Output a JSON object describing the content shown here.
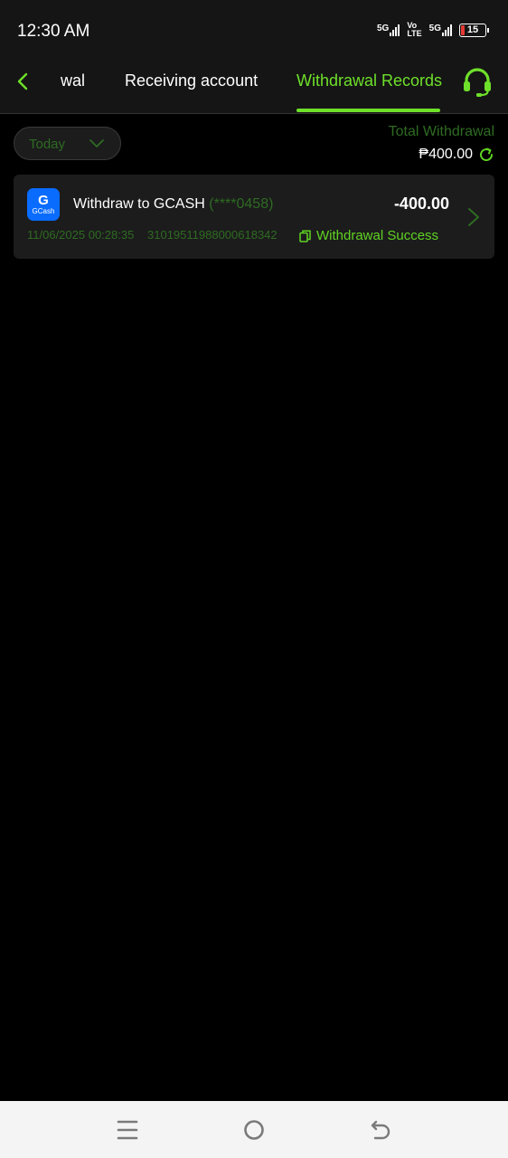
{
  "status_bar": {
    "time": "12:30 AM",
    "network1": "5G",
    "volte_top": "Vo",
    "volte_bottom": "LTE",
    "network2": "5G",
    "battery": "15"
  },
  "nav": {
    "back_icon": "chevron-left-icon",
    "tabs": [
      {
        "label": "wal"
      },
      {
        "label": "Receiving account"
      },
      {
        "label": "Withdrawal Records",
        "active": true
      }
    ],
    "support_icon": "headset-icon"
  },
  "filter": {
    "selected": "Today"
  },
  "summary": {
    "label": "Total Withdrawal",
    "value": "₱400.00"
  },
  "records": [
    {
      "logo_letter": "G",
      "logo_text": "GCash",
      "title": "Withdraw to GCASH",
      "account": "(****0458)",
      "amount": "-400.00",
      "date": "11/06/2025 00:28:35",
      "id": "31019511988000618342",
      "status": "Withdrawal Success"
    }
  ],
  "colors": {
    "accent": "#6ee02a",
    "muted_green": "#2e6b22",
    "card_bg": "#1c1c1c",
    "background": "#000000"
  }
}
